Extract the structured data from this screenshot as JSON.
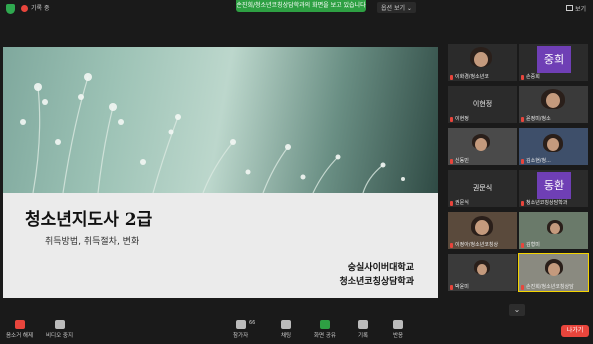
{
  "topbar": {
    "recording_label": "기록 중",
    "share_banner": "손진희/청소년코칭상담학과의 화면을 보고 있습니다",
    "view_options": "옵션 보기 ⌄",
    "view_label": "보기"
  },
  "slide": {
    "title": "청소년지도사 2급",
    "subtitle": "취득방법, 취득절차, 변화",
    "university": "숭실사이버대학교",
    "department": "청소년코칭상담학과"
  },
  "participants": [
    {
      "name": "이화경/청소년코",
      "type": "video",
      "muted": true
    },
    {
      "name": "손중희",
      "type": "avatar",
      "avatar_text": "중희",
      "muted": true
    },
    {
      "name": "이현정",
      "type": "name-only",
      "center": "이현정",
      "muted": true
    },
    {
      "name": "윤정미/청소",
      "type": "video",
      "muted": true
    },
    {
      "name": "신동민",
      "type": "video",
      "muted": true
    },
    {
      "name": "김소현/청...",
      "type": "video",
      "muted": true
    },
    {
      "name": "권문식",
      "type": "name-only",
      "center": "권문식",
      "muted": true
    },
    {
      "name": "청소년코칭상담학과",
      "type": "avatar",
      "avatar_text": "동환",
      "muted": true
    },
    {
      "name": "이정아/청소년코칭상",
      "type": "video",
      "muted": true
    },
    {
      "name": "김형미",
      "type": "video",
      "muted": true
    },
    {
      "name": "박윤미",
      "type": "video",
      "muted": true
    },
    {
      "name": "손진희/청소년코칭상담",
      "type": "video",
      "muted": true
    }
  ],
  "toolbar": {
    "mute": "음소거 해제",
    "video": "비디오 중지",
    "participants": "참가자",
    "participants_count": "66",
    "chat": "채팅",
    "share": "화면 공유",
    "record": "기록",
    "reactions": "반응",
    "leave": "나가기"
  },
  "colors": {
    "share_green": "#2ea043",
    "leave_red": "#e8453c",
    "avatar_purple": "#6f3fb5",
    "highlight_yellow": "#f4d400"
  }
}
